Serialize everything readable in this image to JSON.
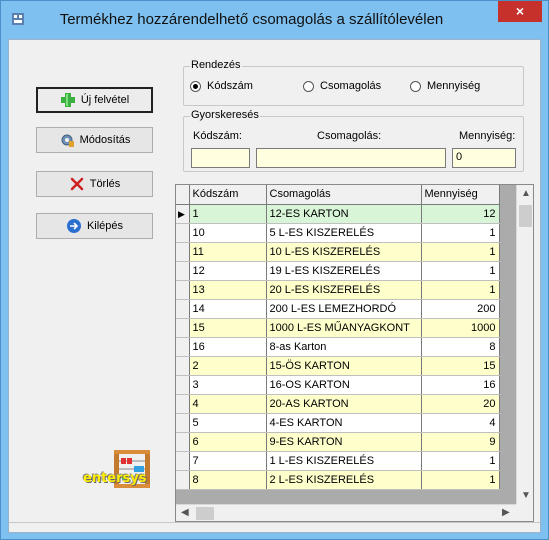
{
  "window": {
    "title": "Termékhez hozzárendelhető csomagolás a szállítólevélen",
    "close_label": "×"
  },
  "buttons": {
    "new": "Új felvétel",
    "modify": "Módosítás",
    "delete": "Törlés",
    "exit": "Kilépés"
  },
  "sort": {
    "label": "Rendezés",
    "options": [
      "Kódszám",
      "Csomagolás",
      "Mennyiség"
    ],
    "selected": "Kódszám"
  },
  "quick_search": {
    "label": "Gyorskeresés",
    "kod_label": "Kódszám:",
    "kod_value": "",
    "cso_label": "Csomagolás:",
    "cso_value": "",
    "menny_label": "Mennyiség:",
    "menny_value": "0"
  },
  "grid": {
    "columns": [
      "Kódszám",
      "Csomagolás",
      "Mennyiség"
    ],
    "rows": [
      {
        "kod": "1",
        "cso": "12-ES KARTON",
        "menny": "12"
      },
      {
        "kod": "10",
        "cso": "5 L-ES KISZERELÉS",
        "menny": "1"
      },
      {
        "kod": "11",
        "cso": "10 L-ES KISZERELÉS",
        "menny": "1"
      },
      {
        "kod": "12",
        "cso": "19 L-ES KISZERELÉS",
        "menny": "1"
      },
      {
        "kod": "13",
        "cso": "20 L-ES KISZERELÉS",
        "menny": "1"
      },
      {
        "kod": "14",
        "cso": "200 L-ES LEMEZHORDÓ",
        "menny": "200"
      },
      {
        "kod": "15",
        "cso": "1000 L-ES MŰANYAGKONT",
        "menny": "1000"
      },
      {
        "kod": "16",
        "cso": "8-as Karton",
        "menny": "8"
      },
      {
        "kod": "2",
        "cso": "15-ÖS KARTON",
        "menny": "15"
      },
      {
        "kod": "3",
        "cso": "16-OS KARTON",
        "menny": "16"
      },
      {
        "kod": "4",
        "cso": "20-AS KARTON",
        "menny": "20"
      },
      {
        "kod": "5",
        "cso": "4-ES KARTON",
        "menny": "4"
      },
      {
        "kod": "6",
        "cso": "9-ES KARTON",
        "menny": "9"
      },
      {
        "kod": "7",
        "cso": "1 L-ES KISZERELÉS",
        "menny": "1"
      },
      {
        "kod": "8",
        "cso": "2 L-ES KISZERELÉS",
        "menny": "1"
      }
    ],
    "selected_index": 0
  },
  "brand": {
    "logo_text": "entersys"
  },
  "colors": {
    "title_bg": "#7ec0ef",
    "close_bg": "#c7312b",
    "row_yellow": "#ffffcc",
    "row_selected": "#d8f5d8",
    "input_bg": "#ffffe0"
  }
}
